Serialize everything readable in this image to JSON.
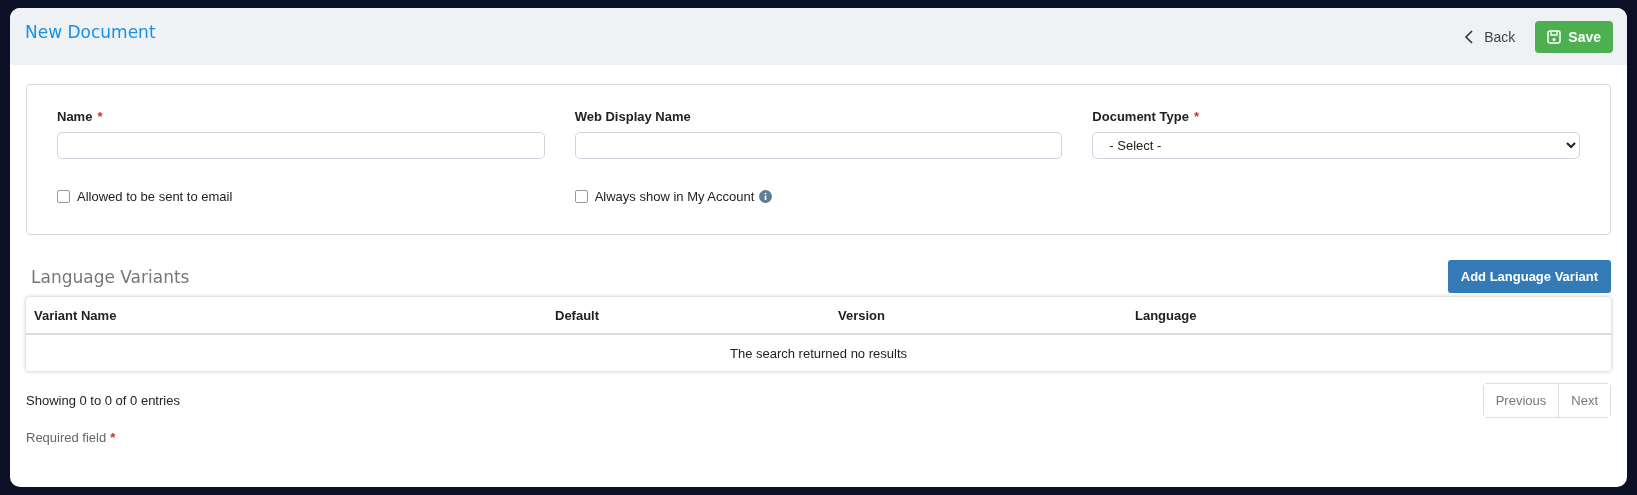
{
  "modal": {
    "title": "New Document",
    "back_label": "Back",
    "save_label": "Save"
  },
  "form": {
    "fields": [
      {
        "kind": "text",
        "label": "Name",
        "required": true
      },
      {
        "kind": "text",
        "label": "Web Display Name",
        "required": false
      },
      {
        "kind": "select",
        "label": "Document Type",
        "required": true,
        "value": "- Select -"
      }
    ],
    "checkboxes": [
      {
        "label": "Allowed to be sent to email",
        "checked": false,
        "info": false
      },
      {
        "label": "Always show in My Account",
        "checked": false,
        "info": true
      }
    ]
  },
  "variants": {
    "title": "Language Variants",
    "add_label": "Add Language Variant",
    "columns": [
      "Variant Name",
      "Default",
      "Version",
      "Language"
    ],
    "empty_message": "The search returned no results",
    "summary": "Showing 0 to 0 of 0 entries",
    "pagination": [
      {
        "label": "Previous",
        "disabled": true
      },
      {
        "label": "Next",
        "disabled": true
      }
    ]
  },
  "footnote": "Required field",
  "required_mark": "*"
}
